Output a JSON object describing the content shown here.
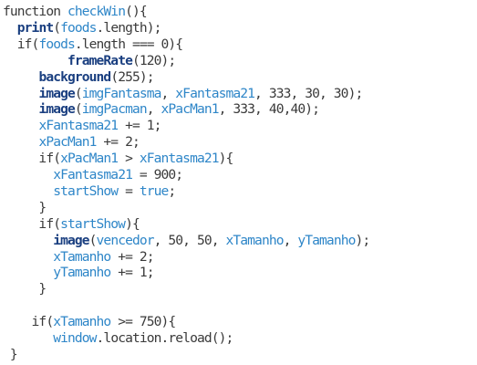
{
  "editor": {
    "colors": {
      "plain": "#3a3a3a",
      "function_call": "#1a3f80",
      "variable": "#2e86c8",
      "background": "#ffffff"
    },
    "lines": [
      [
        {
          "t": "function ",
          "k": "plain"
        },
        {
          "t": "checkWin",
          "k": "var"
        },
        {
          "t": "(){",
          "k": "plain"
        }
      ],
      [
        {
          "t": "  ",
          "k": "plain"
        },
        {
          "t": "print",
          "k": "fn"
        },
        {
          "t": "(",
          "k": "plain"
        },
        {
          "t": "foods",
          "k": "var"
        },
        {
          "t": ".length);",
          "k": "plain"
        }
      ],
      [
        {
          "t": "  if(",
          "k": "plain"
        },
        {
          "t": "foods",
          "k": "var"
        },
        {
          "t": ".length === 0){",
          "k": "plain"
        }
      ],
      [
        {
          "t": "         ",
          "k": "plain"
        },
        {
          "t": "frameRate",
          "k": "fn"
        },
        {
          "t": "(120);",
          "k": "plain"
        }
      ],
      [
        {
          "t": "     ",
          "k": "plain"
        },
        {
          "t": "background",
          "k": "fn"
        },
        {
          "t": "(255);",
          "k": "plain"
        }
      ],
      [
        {
          "t": "     ",
          "k": "plain"
        },
        {
          "t": "image",
          "k": "fn"
        },
        {
          "t": "(",
          "k": "plain"
        },
        {
          "t": "imgFantasma",
          "k": "var"
        },
        {
          "t": ", ",
          "k": "plain"
        },
        {
          "t": "xFantasma21",
          "k": "var"
        },
        {
          "t": ", 333, 30, 30);",
          "k": "plain"
        }
      ],
      [
        {
          "t": "     ",
          "k": "plain"
        },
        {
          "t": "image",
          "k": "fn"
        },
        {
          "t": "(",
          "k": "plain"
        },
        {
          "t": "imgPacman",
          "k": "var"
        },
        {
          "t": ", ",
          "k": "plain"
        },
        {
          "t": "xPacMan1",
          "k": "var"
        },
        {
          "t": ", 333, 40,40);",
          "k": "plain"
        }
      ],
      [
        {
          "t": "     ",
          "k": "plain"
        },
        {
          "t": "xFantasma21",
          "k": "var"
        },
        {
          "t": " += 1;",
          "k": "plain"
        }
      ],
      [
        {
          "t": "     ",
          "k": "plain"
        },
        {
          "t": "xPacMan1",
          "k": "var"
        },
        {
          "t": " += 2;",
          "k": "plain"
        }
      ],
      [
        {
          "t": "     if(",
          "k": "plain"
        },
        {
          "t": "xPacMan1",
          "k": "var"
        },
        {
          "t": " > ",
          "k": "plain"
        },
        {
          "t": "xFantasma21",
          "k": "var"
        },
        {
          "t": "){",
          "k": "plain"
        }
      ],
      [
        {
          "t": "       ",
          "k": "plain"
        },
        {
          "t": "xFantasma21",
          "k": "var"
        },
        {
          "t": " = 900;",
          "k": "plain"
        }
      ],
      [
        {
          "t": "       ",
          "k": "plain"
        },
        {
          "t": "startShow",
          "k": "var"
        },
        {
          "t": " = ",
          "k": "plain"
        },
        {
          "t": "true",
          "k": "var"
        },
        {
          "t": ";",
          "k": "plain"
        }
      ],
      [
        {
          "t": "     }",
          "k": "plain"
        }
      ],
      [
        {
          "t": "     if(",
          "k": "plain"
        },
        {
          "t": "startShow",
          "k": "var"
        },
        {
          "t": "){",
          "k": "plain"
        }
      ],
      [
        {
          "t": "       ",
          "k": "plain"
        },
        {
          "t": "image",
          "k": "fn"
        },
        {
          "t": "(",
          "k": "plain"
        },
        {
          "t": "vencedor",
          "k": "var"
        },
        {
          "t": ", 50, 50, ",
          "k": "plain"
        },
        {
          "t": "xTamanho",
          "k": "var"
        },
        {
          "t": ", ",
          "k": "plain"
        },
        {
          "t": "yTamanho",
          "k": "var"
        },
        {
          "t": ");",
          "k": "plain"
        }
      ],
      [
        {
          "t": "       ",
          "k": "plain"
        },
        {
          "t": "xTamanho",
          "k": "var"
        },
        {
          "t": " += 2;",
          "k": "plain"
        }
      ],
      [
        {
          "t": "       ",
          "k": "plain"
        },
        {
          "t": "yTamanho",
          "k": "var"
        },
        {
          "t": " += 1;",
          "k": "plain"
        }
      ],
      [
        {
          "t": "     }",
          "k": "plain"
        }
      ],
      [],
      [
        {
          "t": "    if(",
          "k": "plain"
        },
        {
          "t": "xTamanho",
          "k": "var"
        },
        {
          "t": " >= 750){",
          "k": "plain"
        }
      ],
      [
        {
          "t": "       ",
          "k": "plain"
        },
        {
          "t": "window",
          "k": "var"
        },
        {
          "t": ".location.reload();",
          "k": "plain"
        }
      ],
      [
        {
          "t": " }",
          "k": "plain"
        }
      ]
    ]
  }
}
